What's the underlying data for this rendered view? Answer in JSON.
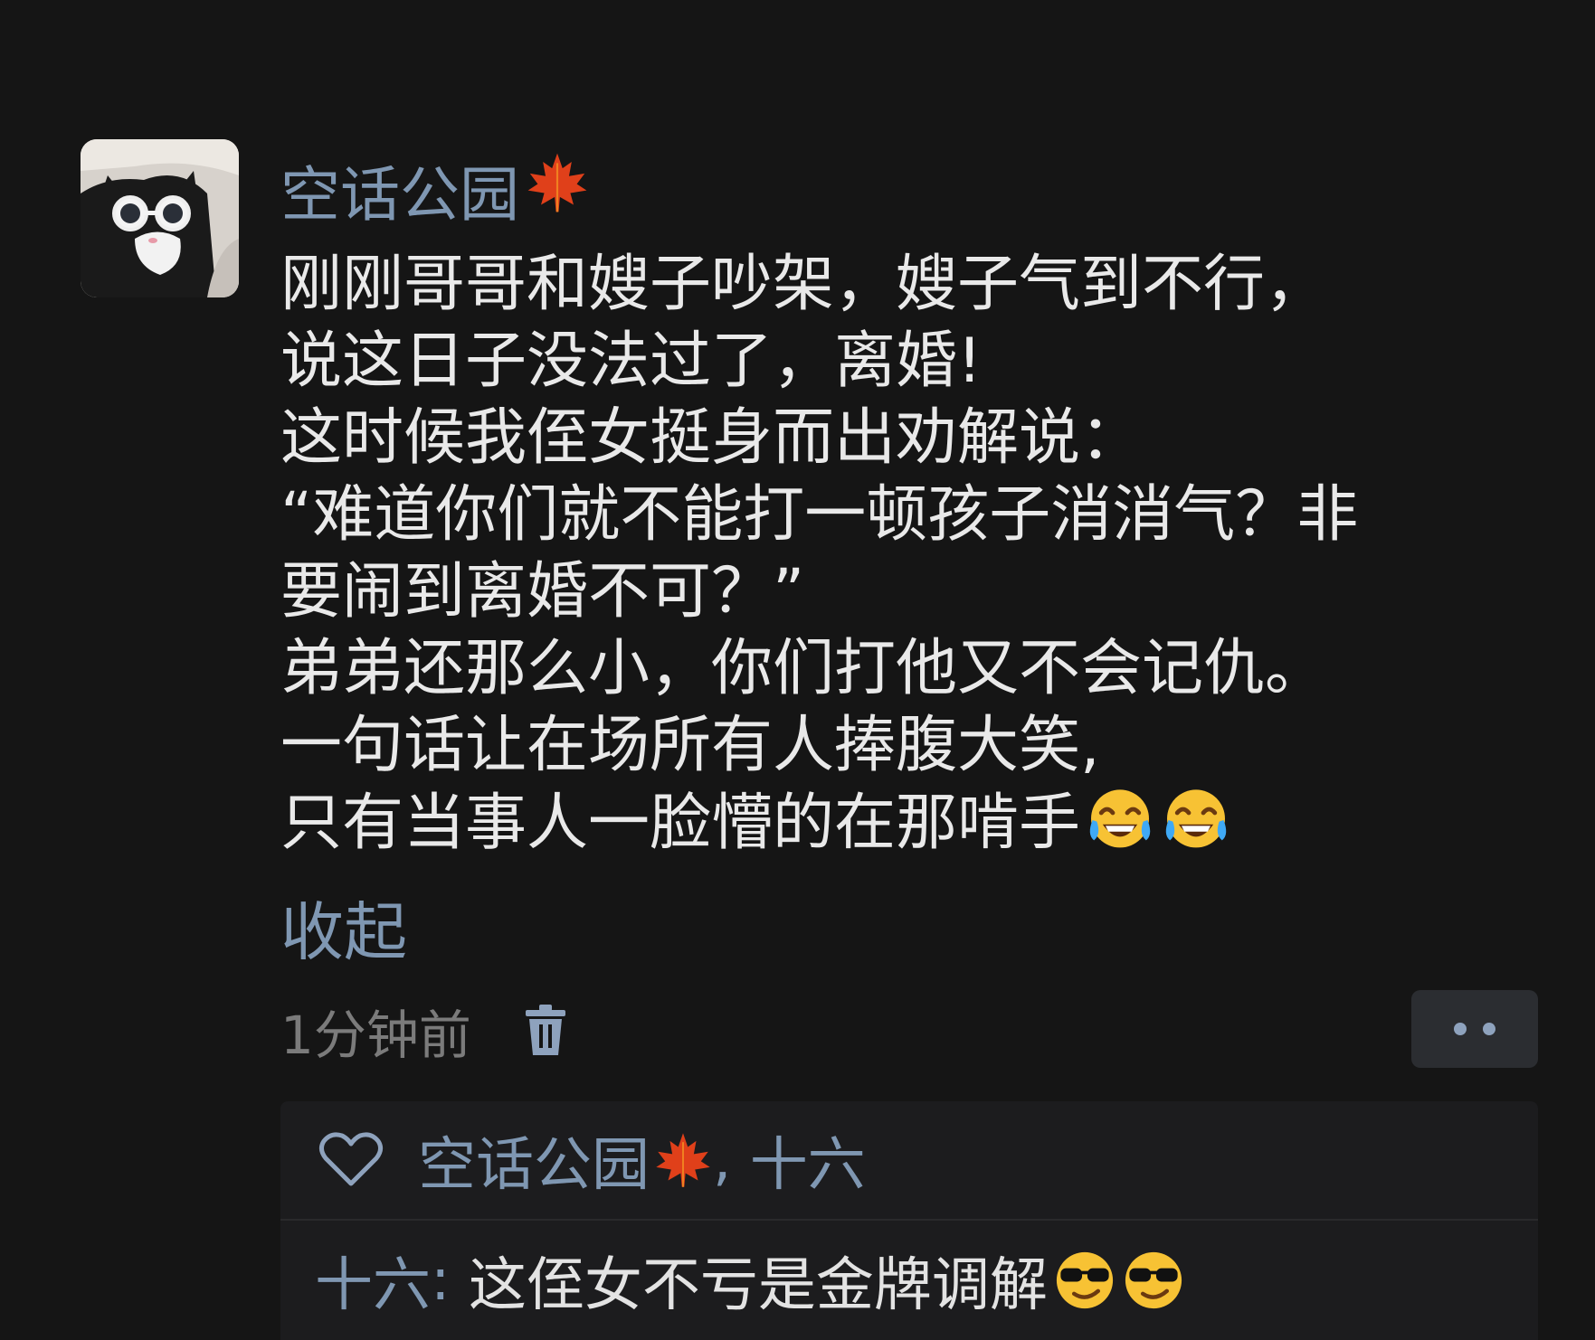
{
  "post": {
    "author": "空话公园",
    "author_badge_icon": "maple-leaf-icon",
    "body_lines": [
      "刚刚哥哥和嫂子吵架，嫂子气到不行，",
      "说这日子没法过了，离婚!",
      "这时候我侄女挺身而出劝解说：",
      "“难道你们就不能打一顿孩子消消气？非",
      "要闹到离婚不可？”",
      "弟弟还那么小，你们打他又不会记仇。",
      "一句话让在场所有人捧腹大笑,",
      "只有当事人一脸懵的在那啃手"
    ],
    "body_trailing_emoji": [
      "tears-of-joy-emoji",
      "tears-of-joy-emoji"
    ],
    "collapse_label": "收起",
    "timestamp": "1分钟前"
  },
  "likes": {
    "users_label": "空话公园",
    "separator": ", ",
    "other_user": "十六"
  },
  "comment": {
    "author": "十六",
    "colon": ": ",
    "text": "这侄女不亏是金牌调解",
    "emoji": [
      "sunglasses-emoji",
      "sunglasses-emoji"
    ]
  },
  "colors": {
    "background": "#151515",
    "link_blue": "#7f97b2",
    "text": "#e9e9e9",
    "muted": "#7b7b7b",
    "panel": "#1c1c1e"
  }
}
